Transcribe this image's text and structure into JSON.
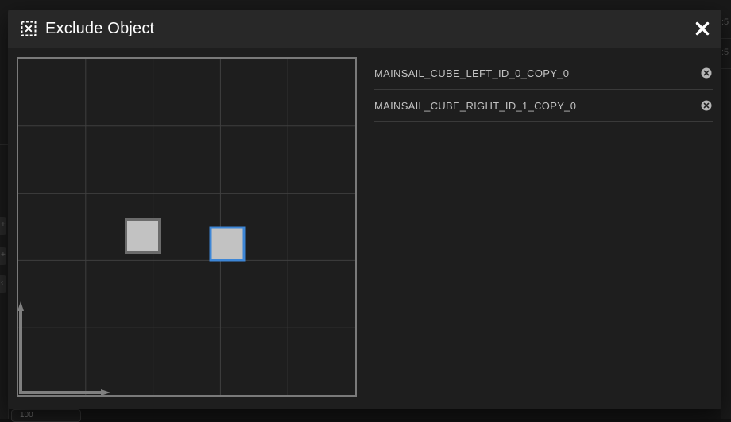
{
  "dialog": {
    "title": "Exclude Object",
    "header_icon": "exclude-object-icon",
    "close_icon": "close-icon"
  },
  "objects": [
    {
      "name": "MAINSAIL_CUBE_LEFT_ID_0_COPY_0",
      "selected": false,
      "remove_icon": "close-circle-icon"
    },
    {
      "name": "MAINSAIL_CUBE_RIGHT_ID_1_COPY_0",
      "selected": true,
      "remove_icon": "close-circle-icon"
    }
  ],
  "background": {
    "right_panel_text": ":5",
    "bottom_tab_text": "100"
  },
  "colors": {
    "dialog_bg": "#1e1e1e",
    "header_bg": "#282828",
    "grid_line": "#3f3f3f",
    "map_border": "#7a7a7a",
    "object_fill": "#c2c2c2",
    "object_border": "#6b6b6b",
    "selected_border": "#3d86d6",
    "axis_arrow": "#808080"
  }
}
